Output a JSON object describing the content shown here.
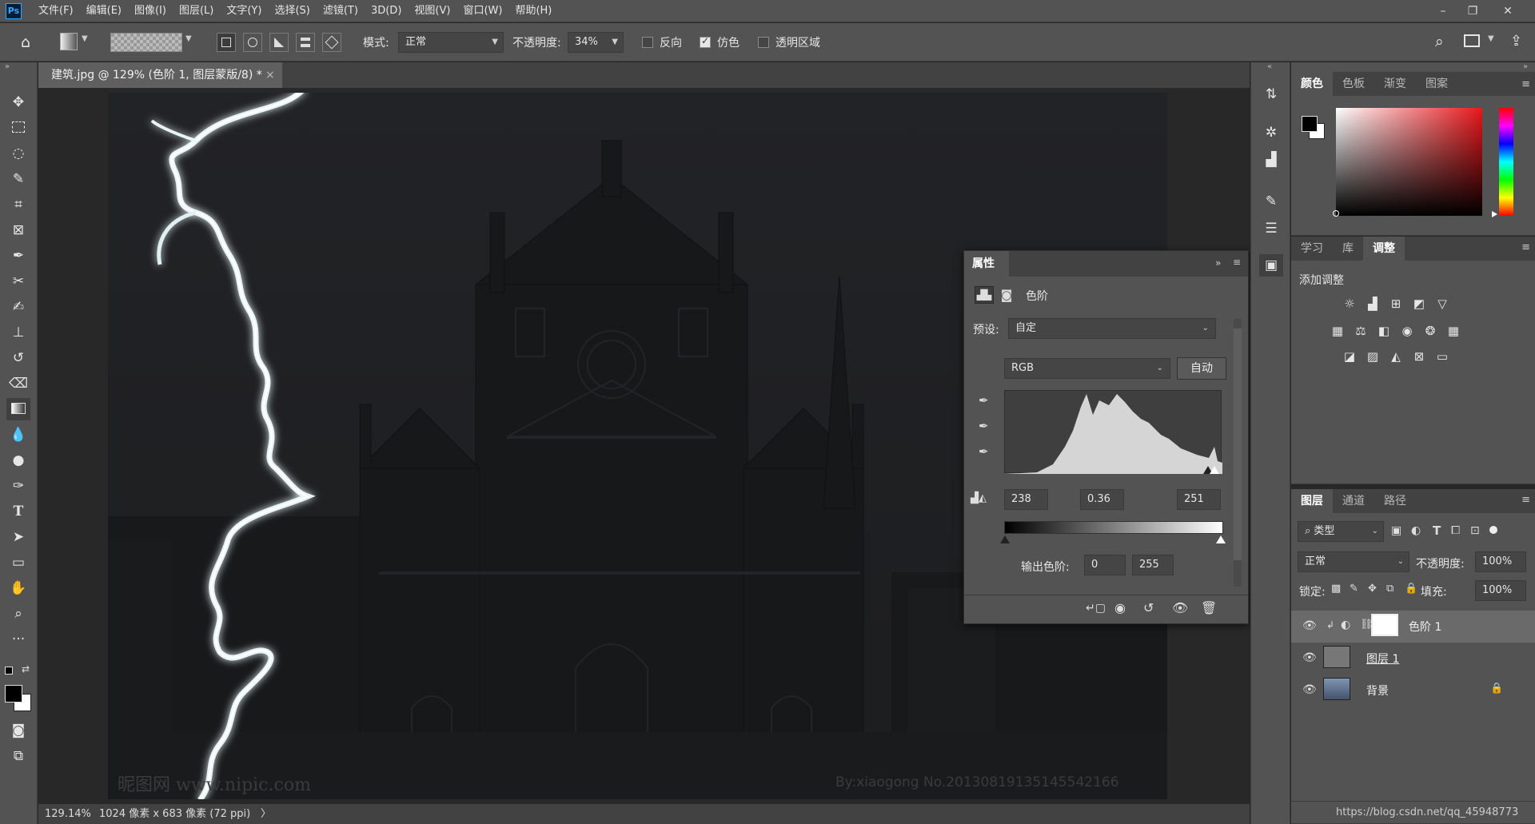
{
  "menu": {
    "logo": "Ps",
    "items": [
      "文件(F)",
      "编辑(E)",
      "图像(I)",
      "图层(L)",
      "文字(Y)",
      "选择(S)",
      "滤镜(T)",
      "3D(D)",
      "视图(V)",
      "窗口(W)",
      "帮助(H)"
    ]
  },
  "window_controls": {
    "minimize": "–",
    "restore": "❐",
    "close": "✕"
  },
  "options": {
    "mode_label": "模式:",
    "mode_value": "正常",
    "opacity_label": "不透明度:",
    "opacity_value": "34%",
    "reverse_label": "反向",
    "reverse_checked": false,
    "dither_label": "仿色",
    "dither_checked": true,
    "transparency_label": "透明区域",
    "transparency_checked": false
  },
  "document": {
    "tab_title": "建筑.jpg @ 129% (色阶 1, 图层蒙版/8) *",
    "tab_close": "×",
    "watermark_left": "昵图网 www.nipic.com",
    "watermark_right": "By:xiaogong  No.20130819135145542166"
  },
  "status": {
    "zoom": "129.14%",
    "info": "1024 像素 x 683 像素 (72 ppi)",
    "arrow": "〉"
  },
  "color_panel": {
    "tabs": [
      "颜色",
      "色板",
      "渐变",
      "图案"
    ],
    "active_tab": 0,
    "foreground": "#000000",
    "background": "#ffffff",
    "hue_color": "#e8171b"
  },
  "adjust_panel": {
    "tabs": [
      "学习",
      "库",
      "调整"
    ],
    "active_tab": 2,
    "title": "添加调整",
    "row1": [
      "brightness-icon",
      "levels-icon",
      "curves-icon",
      "exposure-icon",
      "vibrance-icon"
    ],
    "row2": [
      "hue-saturation-icon",
      "color-balance-icon",
      "black-white-icon",
      "photo-filter-icon",
      "channel-mixer-icon",
      "color-lookup-icon"
    ],
    "row3": [
      "invert-icon",
      "posterize-icon",
      "threshold-icon",
      "selective-color-icon",
      "gradient-map-icon"
    ]
  },
  "properties": {
    "tab": "属性",
    "adjust_name": "色阶",
    "preset_label": "预设:",
    "preset_value": "自定",
    "channel_value": "RGB",
    "auto_button": "自动",
    "input_black": "238",
    "input_gamma": "0.36",
    "input_white": "251",
    "output_label": "输出色阶:",
    "output_black": "0",
    "output_white": "255"
  },
  "layers_panel": {
    "tabs": [
      "图层",
      "通道",
      "路径"
    ],
    "active_tab": 0,
    "filter_label": "类型",
    "blend_mode": "正常",
    "opacity_label": "不透明度:",
    "opacity_value": "100%",
    "lock_label": "锁定:",
    "fill_label": "填充:",
    "fill_value": "100%",
    "layers": [
      {
        "name": "色阶 1",
        "selected": true
      },
      {
        "name": "图层 1",
        "selected": false
      },
      {
        "name": "背景",
        "selected": false
      }
    ],
    "footer_url": "https://blog.csdn.net/qq_45948773"
  }
}
